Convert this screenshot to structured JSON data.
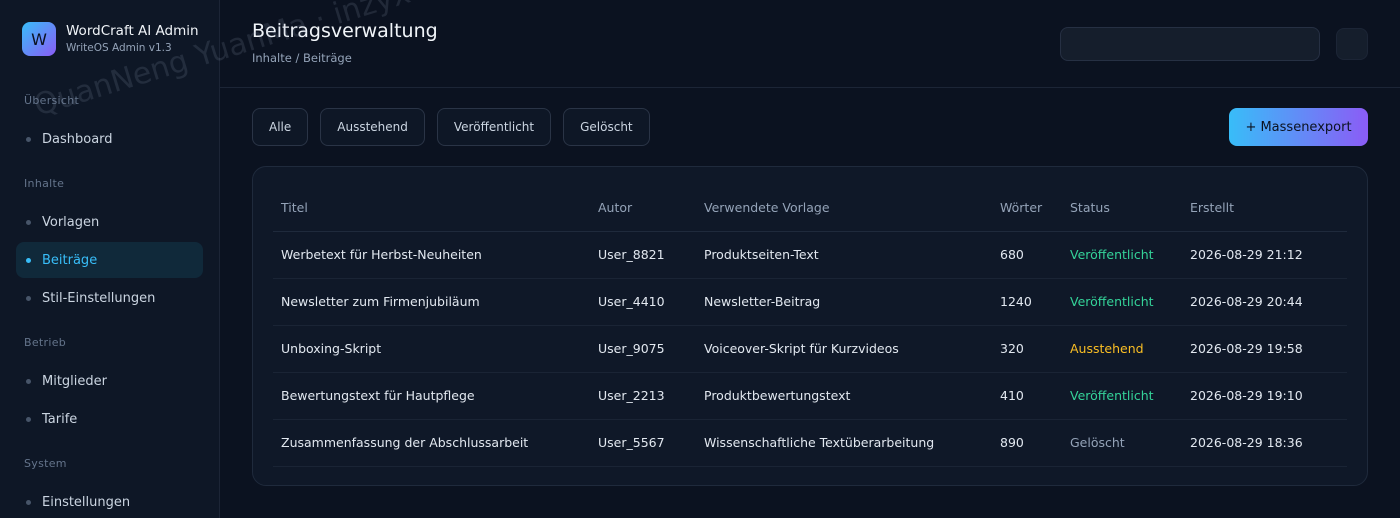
{
  "brand": {
    "logo_letter": "W",
    "name": "WordCraft AI Admin",
    "version": "WriteOS Admin v1.3"
  },
  "sidebar": {
    "groups": [
      {
        "label": "Übersicht",
        "items": [
          {
            "label": "Dashboard",
            "active": false
          }
        ]
      },
      {
        "label": "Inhalte",
        "items": [
          {
            "label": "Vorlagen",
            "active": false
          },
          {
            "label": "Beiträge",
            "active": true
          },
          {
            "label": "Stil-Einstellungen",
            "active": false
          }
        ]
      },
      {
        "label": "Betrieb",
        "items": [
          {
            "label": "Mitglieder",
            "active": false
          },
          {
            "label": "Tarife",
            "active": false
          }
        ]
      },
      {
        "label": "System",
        "items": [
          {
            "label": "Einstellungen",
            "active": false
          }
        ]
      }
    ]
  },
  "header": {
    "title": "Beitragsverwaltung",
    "breadcrumb": "Inhalte / Beiträge",
    "search_value": ""
  },
  "filters": [
    "Alle",
    "Ausstehend",
    "Veröffentlicht",
    "Gelöscht"
  ],
  "export_label": "+ Massenexport",
  "table": {
    "columns": [
      "Titel",
      "Autor",
      "Verwendete Vorlage",
      "Wörter",
      "Status",
      "Erstellt"
    ],
    "rows": [
      [
        "Werbetext für Herbst-Neuheiten",
        "User_8821",
        "Produktseiten-Text",
        "680",
        "Veröffentlicht",
        "2026-08-29 21:12"
      ],
      [
        "Newsletter zum Firmenjubiläum",
        "User_4410",
        "Newsletter-Beitrag",
        "1240",
        "Veröffentlicht",
        "2026-08-29 20:44"
      ],
      [
        "Unboxing-Skript",
        "User_9075",
        "Voiceover-Skript für Kurzvideos",
        "320",
        "Ausstehend",
        "2026-08-29 19:58"
      ],
      [
        "Bewertungstext für Hautpflege",
        "User_2213",
        "Produktbewertungstext",
        "410",
        "Veröffentlicht",
        "2026-08-29 19:10"
      ],
      [
        "Zusammenfassung der Abschlussarbeit",
        "User_5567",
        "Wissenschaftliche Textüberarbeitung",
        "890",
        "Gelöscht",
        "2026-08-29 18:36"
      ]
    ]
  },
  "status_colors": {
    "Veröffentlicht": "#34d399",
    "Ausstehend": "#fbbf24",
    "Gelöscht": "#94a3b8"
  },
  "watermark": "QuanNeng YuanMa · inzyxuashop.com"
}
